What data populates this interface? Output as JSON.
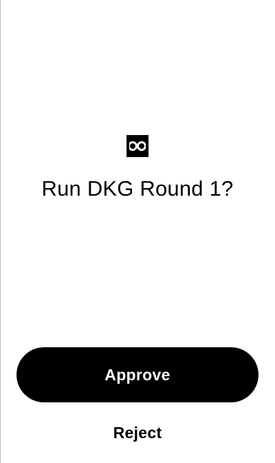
{
  "app": {
    "logo_icon": "two-circle-logo-icon"
  },
  "prompt": {
    "title": "Run DKG Round 1?"
  },
  "actions": {
    "approve_label": "Approve",
    "reject_label": "Reject"
  },
  "colors": {
    "background": "#ffffff",
    "primary": "#000000",
    "on_primary": "#ffffff"
  }
}
